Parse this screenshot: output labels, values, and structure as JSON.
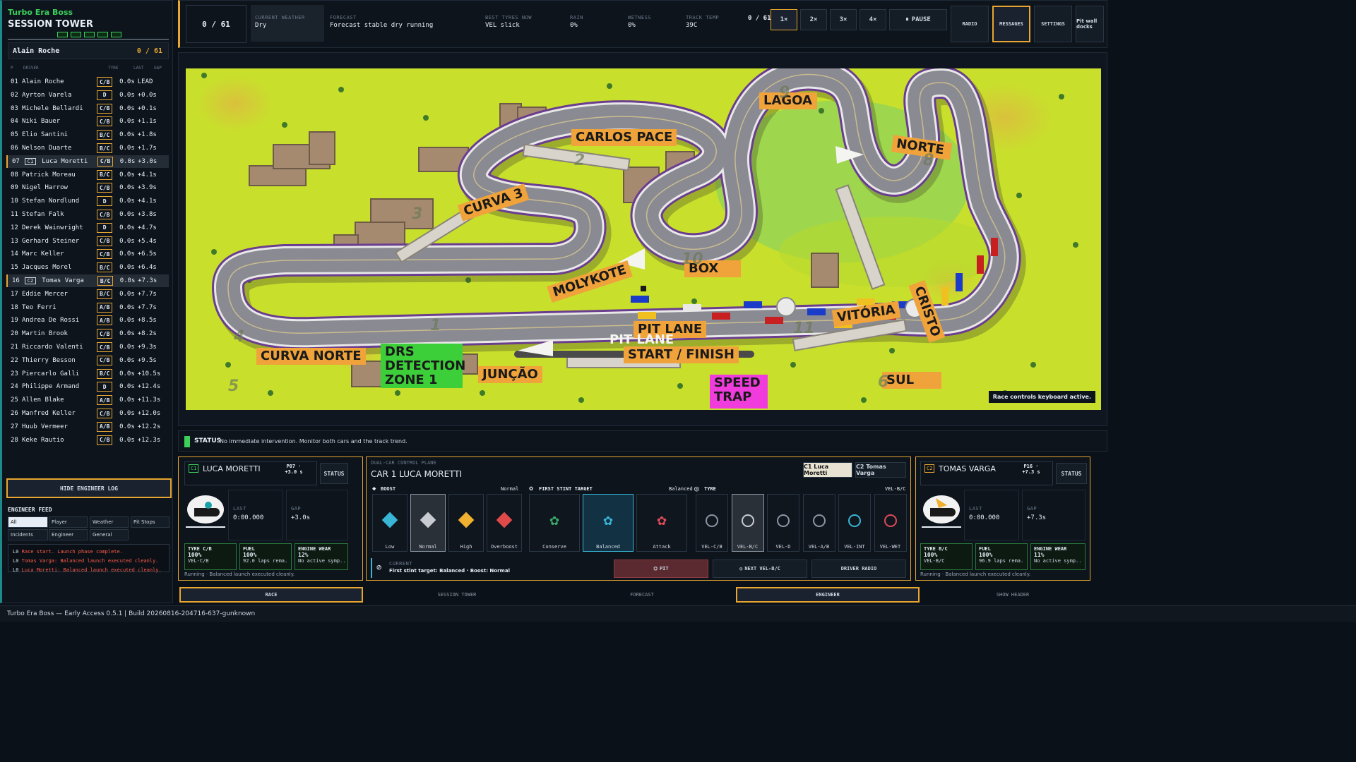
{
  "tower": {
    "brand": "Turbo Era Boss",
    "title": "SESSION TOWER",
    "leader_name": "Alain Roche",
    "lap": "0 / 61",
    "headers": [
      "P",
      "DRIVER",
      "TYRE",
      "LAST",
      "GAP"
    ],
    "rows": [
      {
        "p": "01",
        "name": "Alain Roche",
        "tyre": "C/B",
        "last": "0.0s",
        "gap": "LEAD"
      },
      {
        "p": "02",
        "name": "Ayrton Varela",
        "tyre": "D",
        "last": "0.0s",
        "gap": "+0.0s"
      },
      {
        "p": "03",
        "name": "Michele Bellardi",
        "tyre": "C/B",
        "last": "0.0s",
        "gap": "+0.1s"
      },
      {
        "p": "04",
        "name": "Niki Bauer",
        "tyre": "C/B",
        "last": "0.0s",
        "gap": "+1.1s"
      },
      {
        "p": "05",
        "name": "Elio Santini",
        "tyre": "B/C",
        "last": "0.0s",
        "gap": "+1.8s"
      },
      {
        "p": "06",
        "name": "Nelson Duarte",
        "tyre": "B/C",
        "last": "0.0s",
        "gap": "+1.7s"
      },
      {
        "p": "07",
        "badge": "C1",
        "name": "Luca Moretti",
        "tyre": "C/B",
        "last": "0.0s",
        "gap": "+3.0s",
        "hl": true
      },
      {
        "p": "08",
        "name": "Patrick Moreau",
        "tyre": "B/C",
        "last": "0.0s",
        "gap": "+4.1s"
      },
      {
        "p": "09",
        "name": "Nigel Harrow",
        "tyre": "C/B",
        "last": "0.0s",
        "gap": "+3.9s"
      },
      {
        "p": "10",
        "name": "Stefan Nordlund",
        "tyre": "D",
        "last": "0.0s",
        "gap": "+4.1s"
      },
      {
        "p": "11",
        "name": "Stefan Falk",
        "tyre": "C/B",
        "last": "0.0s",
        "gap": "+3.8s"
      },
      {
        "p": "12",
        "name": "Derek Wainwright",
        "tyre": "D",
        "last": "0.0s",
        "gap": "+4.7s"
      },
      {
        "p": "13",
        "name": "Gerhard Steiner",
        "tyre": "C/B",
        "last": "0.0s",
        "gap": "+5.4s"
      },
      {
        "p": "14",
        "name": "Marc Keller",
        "tyre": "C/B",
        "last": "0.0s",
        "gap": "+6.5s"
      },
      {
        "p": "15",
        "name": "Jacques Morel",
        "tyre": "B/C",
        "last": "0.0s",
        "gap": "+6.4s"
      },
      {
        "p": "16",
        "badge": "C2",
        "name": "Tomas Varga",
        "tyre": "B/C",
        "last": "0.0s",
        "gap": "+7.3s",
        "hl": true
      },
      {
        "p": "17",
        "name": "Eddie Mercer",
        "tyre": "B/C",
        "last": "0.0s",
        "gap": "+7.7s"
      },
      {
        "p": "18",
        "name": "Teo Ferri",
        "tyre": "A/B",
        "last": "0.0s",
        "gap": "+7.7s"
      },
      {
        "p": "19",
        "name": "Andrea De Rossi",
        "tyre": "A/B",
        "last": "0.0s",
        "gap": "+8.5s"
      },
      {
        "p": "20",
        "name": "Martin Brook",
        "tyre": "C/B",
        "last": "0.0s",
        "gap": "+8.2s"
      },
      {
        "p": "21",
        "name": "Riccardo Valenti",
        "tyre": "C/B",
        "last": "0.0s",
        "gap": "+9.3s"
      },
      {
        "p": "22",
        "name": "Thierry Besson",
        "tyre": "C/B",
        "last": "0.0s",
        "gap": "+9.5s"
      },
      {
        "p": "23",
        "name": "Piercarlo Galli",
        "tyre": "B/C",
        "last": "0.0s",
        "gap": "+10.5s"
      },
      {
        "p": "24",
        "name": "Philippe Armand",
        "tyre": "D",
        "last": "0.0s",
        "gap": "+12.4s"
      },
      {
        "p": "25",
        "name": "Allen Blake",
        "tyre": "A/B",
        "last": "0.0s",
        "gap": "+11.3s"
      },
      {
        "p": "26",
        "name": "Manfred Keller",
        "tyre": "C/B",
        "last": "0.0s",
        "gap": "+12.0s"
      },
      {
        "p": "27",
        "name": "Huub Vermeer",
        "tyre": "A/B",
        "last": "0.0s",
        "gap": "+12.2s"
      },
      {
        "p": "28",
        "name": "Keke Rautio",
        "tyre": "C/B",
        "last": "0.0s",
        "gap": "+12.3s"
      }
    ]
  },
  "engineer": {
    "hide_log": "HIDE ENGINEER LOG",
    "feed_title": "ENGINEER FEED",
    "filters": [
      "All",
      "Player",
      "Weather",
      "Pit Stops",
      "Incidents",
      "Engineer",
      "General"
    ],
    "log": [
      {
        "lap": "L0",
        "text": "Race start. Launch phase complete."
      },
      {
        "lap": "L0",
        "text": "Tomas Varga: Balanced launch executed cleanly."
      },
      {
        "lap": "L0",
        "text": "Luca Moretti: Balanced launch executed cleanly."
      }
    ]
  },
  "header": {
    "lap": "0 / 61",
    "weather_label": "CURRENT WEATHER",
    "weather": "Dry",
    "forecast_label": "FORECAST",
    "forecast": "Forecast stable dry running",
    "tyres_label": "BEST TYRES NOW",
    "tyres": "VEL slick",
    "rain_label": "RAIN",
    "rain": "0%",
    "wetness_label": "WETNESS",
    "wetness": "0%",
    "temp_label": "TRACK TEMP",
    "temp": "39C",
    "lap_small": "0 / 61",
    "speeds": [
      "1×",
      "2×",
      "3×",
      "4×"
    ],
    "pause": "PAUSE",
    "tabs": [
      "RADIO",
      "MESSAGES",
      "SETTINGS",
      "Pit wall docks"
    ]
  },
  "track": {
    "labels": {
      "lagoa": "LAGOA",
      "carlos_pace": "CARLOS PACE",
      "norte": "NORTE",
      "curva3": "CURVA 3",
      "box": "BOX",
      "molykote": "MOLYKOTE",
      "cristo": "CRISTO",
      "vitoria": "VITÓRIA",
      "pit_lane": "PIT LANE",
      "pit_lane2": "PIT LANE",
      "start_finish": "START / FINISH",
      "curva_norte": "CURVA NORTE",
      "drs": "DRS DETECTION ZONE 1",
      "juncao": "JUNÇÃO",
      "speed_trap": "SPEED TRAP",
      "sul": "SUL"
    },
    "turn_numbers": [
      "1",
      "2",
      "3",
      "4",
      "5",
      "6",
      "8",
      "9",
      "10",
      "11"
    ],
    "hint": "Race controls keyboard active."
  },
  "status": {
    "label": "STATUS",
    "text": "No immediate intervention. Monitor both cars and the track trend."
  },
  "car1": {
    "badge": "C1",
    "name": "LUCA MORETTI",
    "pos": "P07 · +3.0 s",
    "status_btn": "STATUS",
    "last_label": "LAST",
    "last": "0:00.000",
    "gap_label": "GAP",
    "gap": "+3.0s",
    "tyre_label": "TYRE C/B",
    "tyre_pct": "100%",
    "tyre_sub": "VEL-C/B",
    "fuel_label": "FUEL",
    "fuel_pct": "100%",
    "fuel_sub": "92.0 laps rema...",
    "wear_label": "ENGINE WEAR",
    "wear_pct": "12%",
    "wear_sub": "No active symp...",
    "note": "Running · Balanced launch executed cleanly."
  },
  "car2": {
    "badge": "C2",
    "name": "TOMAS VARGA",
    "pos": "P16 · +7.3 s",
    "status_btn": "STATUS",
    "last_label": "LAST",
    "last": "0:00.000",
    "gap_label": "GAP",
    "gap": "+7.3s",
    "tyre_label": "TYRE B/C",
    "tyre_pct": "100%",
    "tyre_sub": "VEL-B/C",
    "fuel_label": "FUEL",
    "fuel_pct": "100%",
    "fuel_sub": "96.9 laps rema...",
    "wear_label": "ENGINE WEAR",
    "wear_pct": "11%",
    "wear_sub": "No active symp...",
    "note": "Running · Balanced launch executed cleanly."
  },
  "control": {
    "plane_label": "DUAL-CAR CONTROL PLANE",
    "title": "CAR 1 LUCA MORETTI",
    "car_tabs": [
      "C1 Luca Moretti",
      "C2 Tomas Varga"
    ],
    "boost_label": "BOOST",
    "boost_val": "Normal",
    "boost_opts": [
      "Low",
      "Normal",
      "High",
      "Overboost"
    ],
    "stint_label": "FIRST STINT TARGET",
    "stint_val": "Balanced",
    "stint_opts": [
      "Conserve",
      "Balanced",
      "Attack"
    ],
    "tyre_label": "TYRE",
    "tyre_val": "VEL-B/C",
    "tyre_opts": [
      "VEL-C/B",
      "VEL-B/C",
      "VEL-D",
      "VEL-A/B",
      "VEL-INT",
      "VEL-WET"
    ],
    "current_label": "CURRENT",
    "current": "First stint target: Balanced · Boost: Normal",
    "pit": "PIT",
    "next": "NEXT VEL-B/C",
    "radio": "DRIVER RADIO"
  },
  "bottom_tabs": [
    "RACE",
    "SESSION TOWER",
    "FORECAST",
    "ENGINEER",
    "SHOW HEADER"
  ],
  "footer": "Turbo Era Boss — Early Access 0.5.1 | Build 20260816-204716-637-gunknown",
  "colors": {
    "accent": "#e8a630",
    "panel": "#0d141c",
    "grass": "#c8e02c",
    "label": "#f0a33a"
  }
}
